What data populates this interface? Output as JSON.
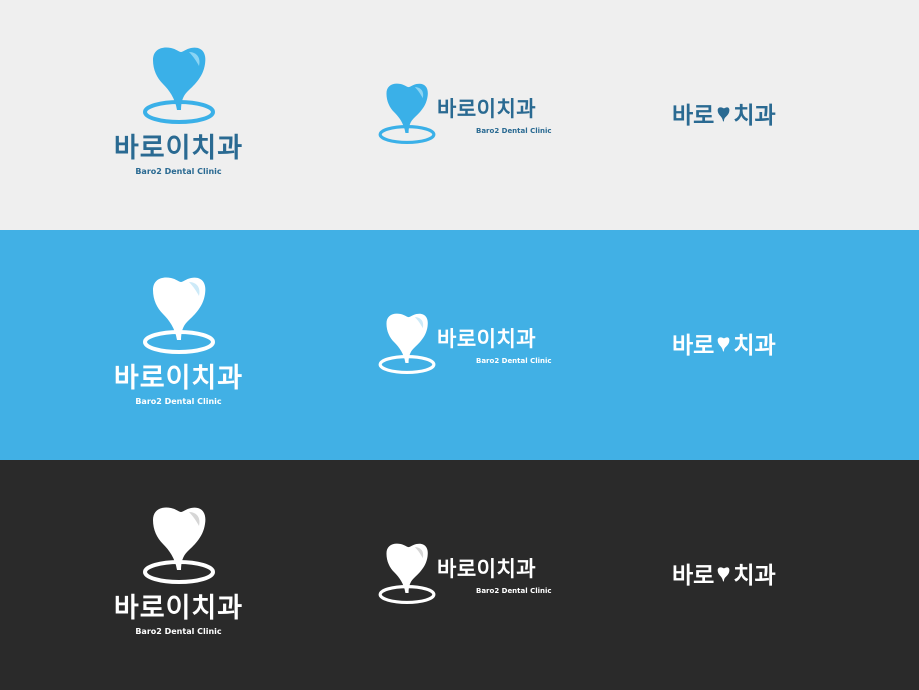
{
  "brand": {
    "name_korean": "바로이치과",
    "name_english": "Baro2 Dental Clinic",
    "wordmark_left": "바로",
    "wordmark_right": "치과",
    "logo_icon": "tooth-icon"
  },
  "variants": [
    {
      "id": "light",
      "background": "#efefef",
      "text_color": "#2a6a92",
      "icon_color": "#3ab0e8",
      "icon_highlight": "#8ad4f4"
    },
    {
      "id": "blue",
      "background": "#41b0e5",
      "text_color": "#ffffff",
      "icon_color": "#ffffff",
      "icon_highlight": "#cdeaf8"
    },
    {
      "id": "dark",
      "background": "#2a2a2a",
      "text_color": "#ffffff",
      "icon_color": "#ffffff",
      "icon_highlight": "#d6d6d6"
    }
  ]
}
